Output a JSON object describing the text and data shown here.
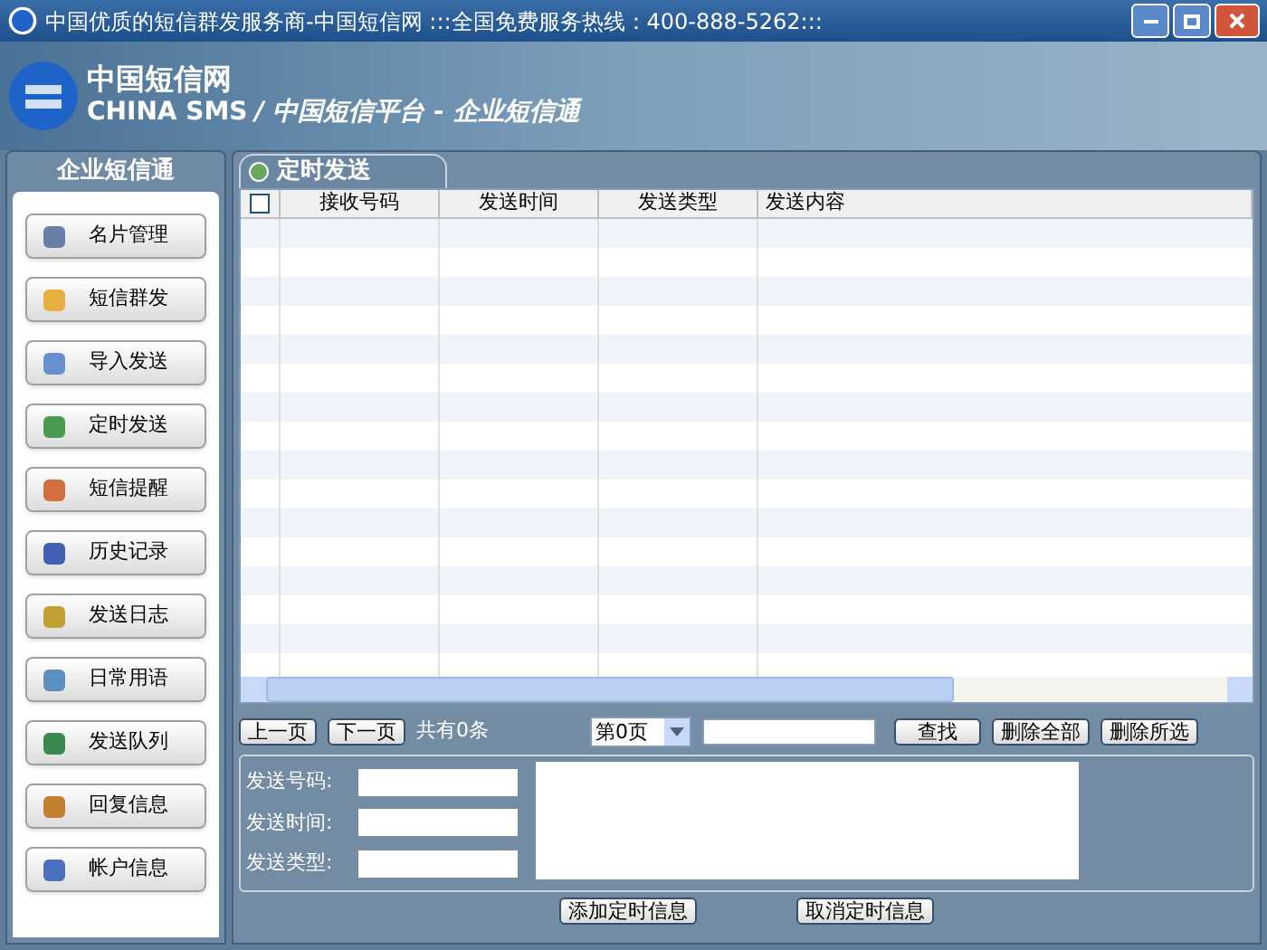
{
  "window": {
    "title": "中国优质的短信群发服务商-中国短信网 :::全国免费服务热线：400-888-5262:::"
  },
  "header": {
    "logo_cn": "中国短信网",
    "logo_en": "CHINA SMS",
    "slogan": "/ 中国短信平台 - 企业短信通"
  },
  "sidebar": {
    "title": "企业短信通",
    "items": [
      "名片管理",
      "短信群发",
      "导入发送",
      "定时发送",
      "短信提醒",
      "历史记录",
      "发送日志",
      "日常用语",
      "发送队列",
      "回复信息",
      "帐户信息"
    ]
  },
  "panel": {
    "title": "定时发送"
  },
  "table": {
    "select_all": {
      "checked": false
    },
    "columns": [
      "接收号码",
      "发送时间",
      "发送类型",
      "发送内容"
    ]
  },
  "pager": {
    "prev": "上一页",
    "next": "下一页",
    "total": "共有0条",
    "page": "第0页",
    "search": "查找",
    "delete_all": "删除全部",
    "delete_selected": "删除所选"
  },
  "form": {
    "fields": [
      "发送号码:",
      "发送时间:",
      "发送类型:"
    ]
  },
  "actions": [
    "添加定时信息",
    "取消定时信息"
  ]
}
